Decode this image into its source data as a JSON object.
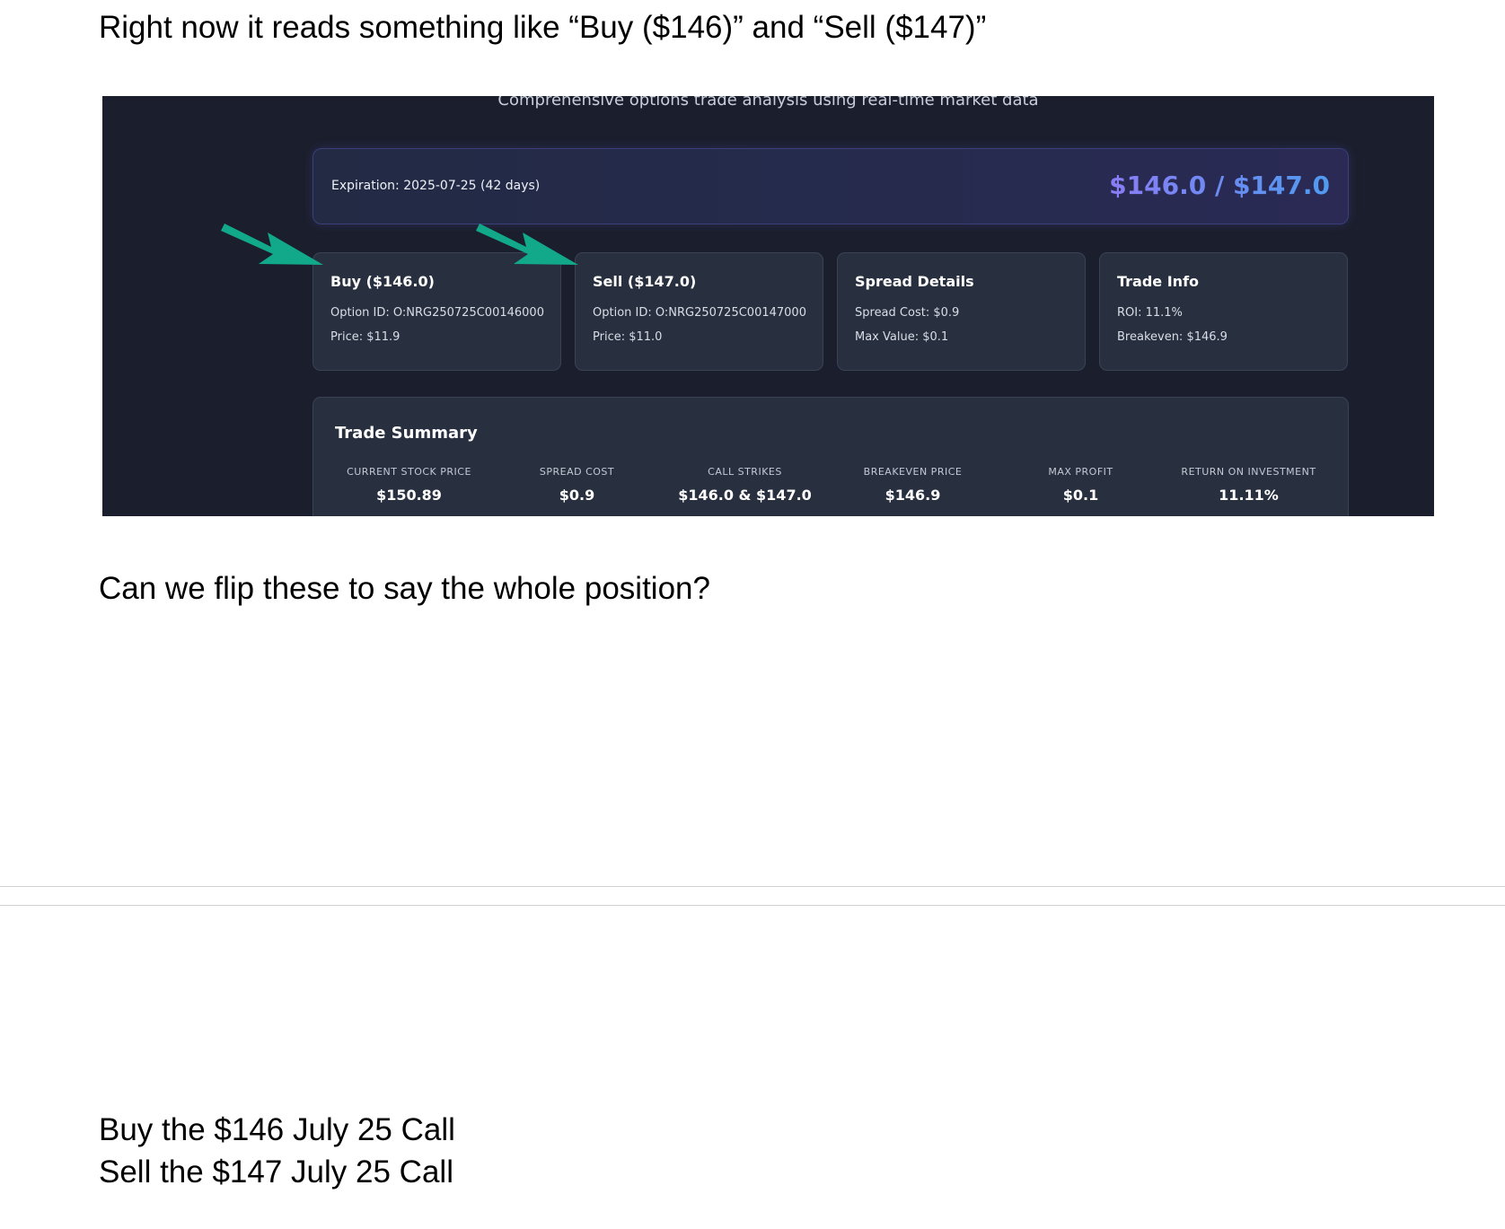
{
  "doc": {
    "line1": "Right now it reads something like “Buy ($146)” and “Sell ($147)”",
    "line2": "Can we flip these to say the whole position?",
    "line3": "Buy the $146 July 25 Call",
    "line4": "Sell the $147 July 25 Call"
  },
  "screenshot": {
    "subtitle": "Comprehensive options trade analysis using real-time market data",
    "expiration": "Expiration: 2025-07-25 (42 days)",
    "strike_pair": "$146.0 / $147.0",
    "cards": [
      {
        "title": "Buy ($146.0)",
        "line1": "Option ID: O:NRG250725C00146000",
        "line2": "Price: $11.9"
      },
      {
        "title": "Sell ($147.0)",
        "line1": "Option ID: O:NRG250725C00147000",
        "line2": "Price: $11.0"
      },
      {
        "title": "Spread Details",
        "line1": "Spread Cost: $0.9",
        "line2": "Max Value: $0.1"
      },
      {
        "title": "Trade Info",
        "line1": "ROI: 11.1%",
        "line2": "Breakeven: $146.9"
      }
    ],
    "summary": {
      "title": "Trade Summary",
      "metrics": [
        {
          "label": "CURRENT STOCK PRICE",
          "value": "$150.89"
        },
        {
          "label": "SPREAD COST",
          "value": "$0.9"
        },
        {
          "label": "CALL STRIKES",
          "value": "$146.0 & $147.0"
        },
        {
          "label": "BREAKEVEN PRICE",
          "value": "$146.9"
        },
        {
          "label": "MAX PROFIT",
          "value": "$0.1"
        },
        {
          "label": "RETURN ON INVESTMENT",
          "value": "11.11%"
        }
      ]
    },
    "colors": {
      "arrow": "#12a88a",
      "background": "#1b1f2d",
      "accent_start": "#8a7cf5",
      "accent_end": "#4f9bf0"
    }
  }
}
